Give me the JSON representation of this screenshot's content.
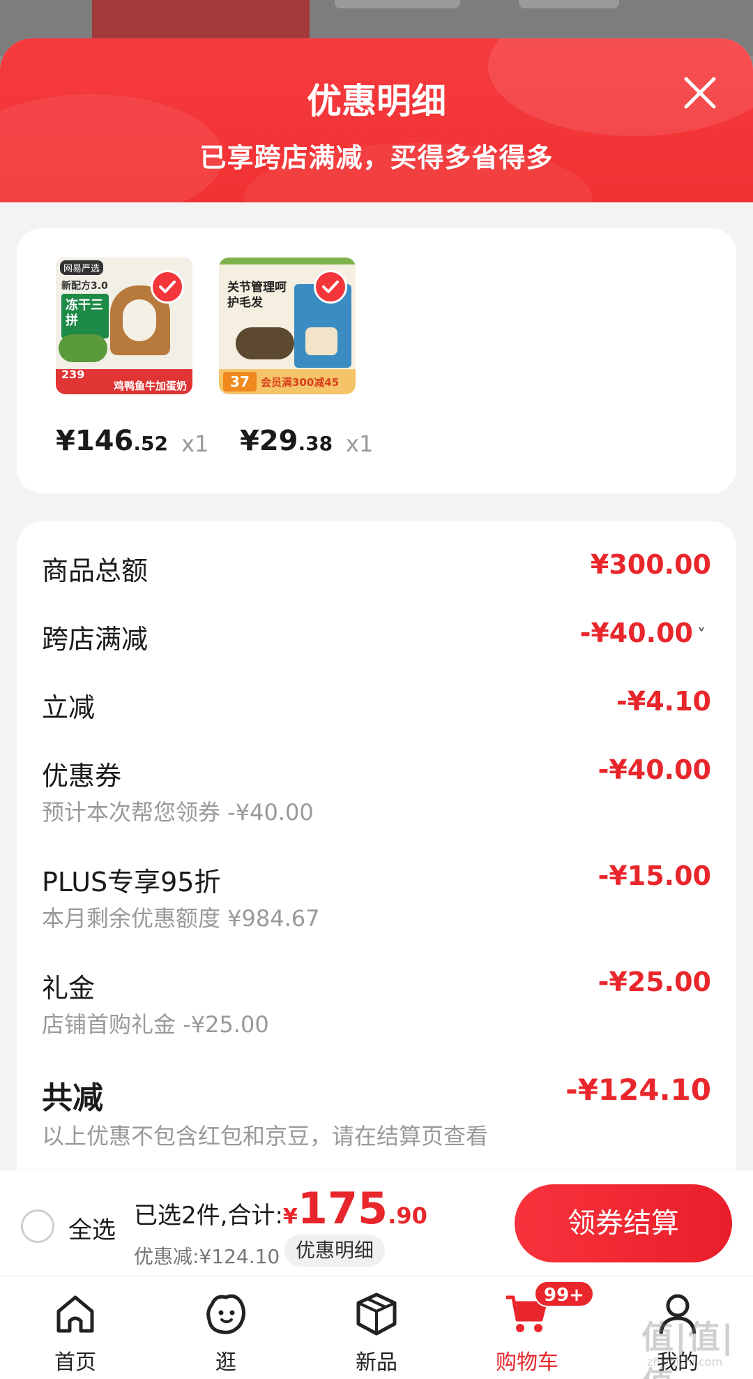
{
  "sheet": {
    "title": "优惠明细",
    "subtitle": "已享跨店满减，买得多省得多"
  },
  "products": [
    {
      "thumb_brand": "网易严选",
      "thumb_tag": "新配方3.0",
      "thumb_green": "冻干三拼",
      "thumb_price": "239",
      "thumb_bottom": "鸡鸭鱼牛加蛋奶",
      "price_yen": "¥",
      "price_int": "146",
      "price_dec": ".52",
      "qty": "x1"
    },
    {
      "thumb_title": "关节管理呵护毛发",
      "thumb_num": "37",
      "thumb_promo": "会员满300减45",
      "price_yen": "¥",
      "price_int": "29",
      "price_dec": ".38",
      "qty": "x1"
    }
  ],
  "breakdown": {
    "goods_total": {
      "label": "商品总额",
      "amount": "¥300.00"
    },
    "cross_store": {
      "label": "跨店满减",
      "amount": "-¥40.00",
      "chevron": "˅"
    },
    "instant": {
      "label": "立减",
      "amount": "-¥4.10"
    },
    "coupon": {
      "label": "优惠券",
      "sub": "预计本次帮您领券 -¥40.00",
      "amount": "-¥40.00"
    },
    "plus": {
      "label": "PLUS专享95折",
      "sub": "本月剩余优惠额度 ¥984.67",
      "amount": "-¥15.00"
    },
    "gift": {
      "label": "礼金",
      "sub": "店铺首购礼金 -¥25.00",
      "amount": "-¥25.00"
    },
    "total": {
      "label": "共减",
      "sub": "以上优惠不包含红包和京豆，请在结算页查看",
      "amount": "-¥124.10"
    }
  },
  "checkout": {
    "select_all": "全选",
    "selected_text": "已选2件,合计:",
    "yen": "¥",
    "total_int": "175",
    "total_dec": ".90",
    "discount_text": "优惠减:¥124.10",
    "detail_chip": "优惠明细",
    "button": "领券结算"
  },
  "tabbar": {
    "tabs": [
      {
        "label": "首页",
        "icon": "home-icon"
      },
      {
        "label": "逛",
        "icon": "face-icon"
      },
      {
        "label": "新品",
        "icon": "box-icon"
      },
      {
        "label": "购物车",
        "icon": "cart-icon",
        "badge": "99+",
        "active": true
      },
      {
        "label": "我的",
        "icon": "user-icon"
      }
    ]
  },
  "watermark": {
    "main": "值|值|值",
    "sub": "zhizhizhi.com"
  },
  "colors": {
    "accent": "#e8262b",
    "header": "#f13132",
    "muted": "#999999"
  }
}
